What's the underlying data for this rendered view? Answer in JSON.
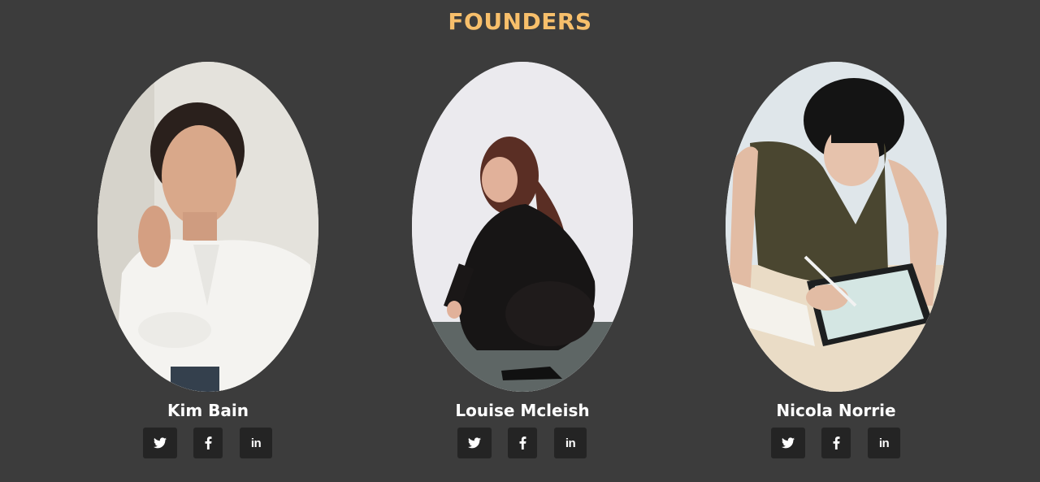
{
  "section": {
    "title": "FOUNDERS"
  },
  "founders": [
    {
      "name": "Kim Bain",
      "photo_icon": "portrait-photo",
      "socials": [
        "twitter-icon",
        "facebook-icon",
        "linkedin-icon"
      ]
    },
    {
      "name": "Louise Mcleish",
      "photo_icon": "portrait-photo",
      "socials": [
        "twitter-icon",
        "facebook-icon",
        "linkedin-icon"
      ]
    },
    {
      "name": "Nicola Norrie",
      "photo_icon": "portrait-photo",
      "socials": [
        "twitter-icon",
        "facebook-icon",
        "linkedin-icon"
      ]
    }
  ],
  "colors": {
    "background": "#3c3c3c",
    "title": "#f7bf6b",
    "button": "#242424",
    "text": "#ffffff"
  }
}
